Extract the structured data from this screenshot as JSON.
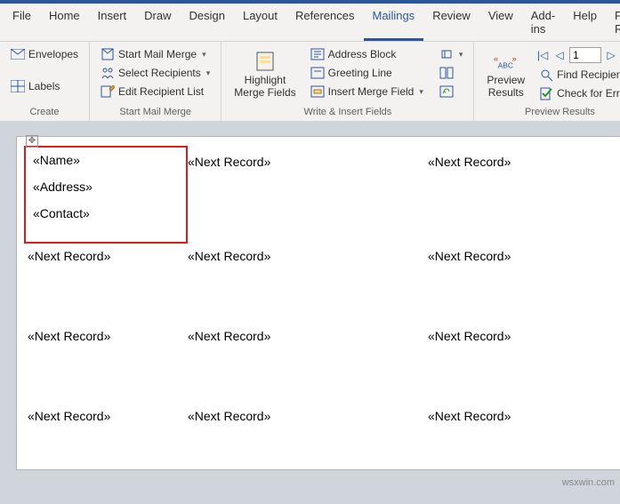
{
  "tabs": [
    "File",
    "Home",
    "Insert",
    "Draw",
    "Design",
    "Layout",
    "References",
    "Mailings",
    "Review",
    "View",
    "Add-ins",
    "Help",
    "Foxit Reade"
  ],
  "active_tab": "Mailings",
  "groups": {
    "create": {
      "label": "Create",
      "envelopes": "Envelopes",
      "labels": "Labels"
    },
    "start_mail_merge": {
      "label": "Start Mail Merge",
      "start": "Start Mail Merge",
      "select": "Select Recipients",
      "edit": "Edit Recipient List"
    },
    "write_insert": {
      "label": "Write & Insert Fields",
      "highlight": "Highlight\nMerge Fields",
      "address_block": "Address Block",
      "greeting_line": "Greeting Line",
      "insert_merge": "Insert Merge Field"
    },
    "preview": {
      "label": "Preview Results",
      "preview_btn": "Preview\nResults",
      "find": "Find Recipient",
      "check": "Check for Errors",
      "record_num": "1",
      "abc": "ABC"
    }
  },
  "doc": {
    "fields": {
      "name": "«Name»",
      "address": "«Address»",
      "contact": "«Contact»"
    },
    "next_record": "«Next Record»"
  },
  "watermark": "wsxwin.com"
}
